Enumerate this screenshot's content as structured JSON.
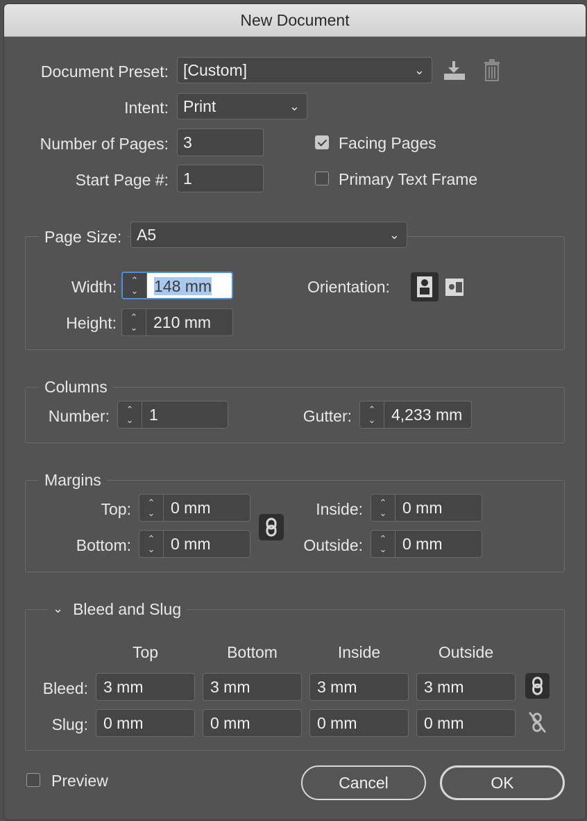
{
  "window": {
    "title": "New Document"
  },
  "preset": {
    "label": "Document Preset:",
    "value": "[Custom]",
    "save_icon": "download-icon",
    "delete_icon": "trash-icon"
  },
  "intent": {
    "label": "Intent:",
    "value": "Print"
  },
  "pages": {
    "label": "Number of Pages:",
    "value": "3"
  },
  "start_page": {
    "label": "Start Page #:",
    "value": "1"
  },
  "facing_pages": {
    "label": "Facing Pages",
    "checked": true
  },
  "primary_text_frame": {
    "label": "Primary Text Frame",
    "checked": false
  },
  "page_size": {
    "label": "Page Size:",
    "value": "A5",
    "width_label": "Width:",
    "width": "148 mm",
    "height_label": "Height:",
    "height": "210 mm",
    "orientation_label": "Orientation:",
    "orientation": "portrait"
  },
  "columns": {
    "title": "Columns",
    "number_label": "Number:",
    "number": "1",
    "gutter_label": "Gutter:",
    "gutter": "4,233 mm"
  },
  "margins": {
    "title": "Margins",
    "top_label": "Top:",
    "top": "0 mm",
    "bottom_label": "Bottom:",
    "bottom": "0 mm",
    "inside_label": "Inside:",
    "inside": "0 mm",
    "outside_label": "Outside:",
    "outside": "0 mm",
    "linked": true
  },
  "bleed_slug": {
    "title": "Bleed and Slug",
    "headers": [
      "Top",
      "Bottom",
      "Inside",
      "Outside"
    ],
    "bleed_label": "Bleed:",
    "bleed": [
      "3 mm",
      "3 mm",
      "3 mm",
      "3 mm"
    ],
    "slug_label": "Slug:",
    "slug": [
      "0 mm",
      "0 mm",
      "0 mm",
      "0 mm"
    ]
  },
  "preview": {
    "label": "Preview",
    "checked": false
  },
  "buttons": {
    "cancel": "Cancel",
    "ok": "OK"
  },
  "colors": {
    "background": "#535353",
    "field": "#454545",
    "focus": "#4b8fe0"
  }
}
